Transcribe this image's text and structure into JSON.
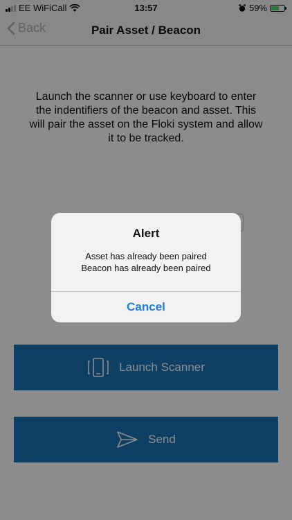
{
  "status_bar": {
    "carrier": "EE WiFiCall",
    "time": "13:57",
    "battery": "59%",
    "battery_level": 0.59
  },
  "nav": {
    "back_label": "Back",
    "title": "Pair Asset / Beacon"
  },
  "main": {
    "instructions": "Launch the scanner or use keyboard to enter the indentifiers of the beacon and asset. This will pair the asset on the Floki system and allow it to be tracked.",
    "field_1_partial": "",
    "field_2_partial": ""
  },
  "buttons": {
    "launch_scanner": "Launch Scanner",
    "send": "Send"
  },
  "alert": {
    "title": "Alert",
    "line1": "Asset has already been paired",
    "line2": "Beacon has already been paired",
    "cancel": "Cancel"
  },
  "colors": {
    "button_blue": "#1a73b8",
    "alert_link_blue": "#1e7de0"
  }
}
